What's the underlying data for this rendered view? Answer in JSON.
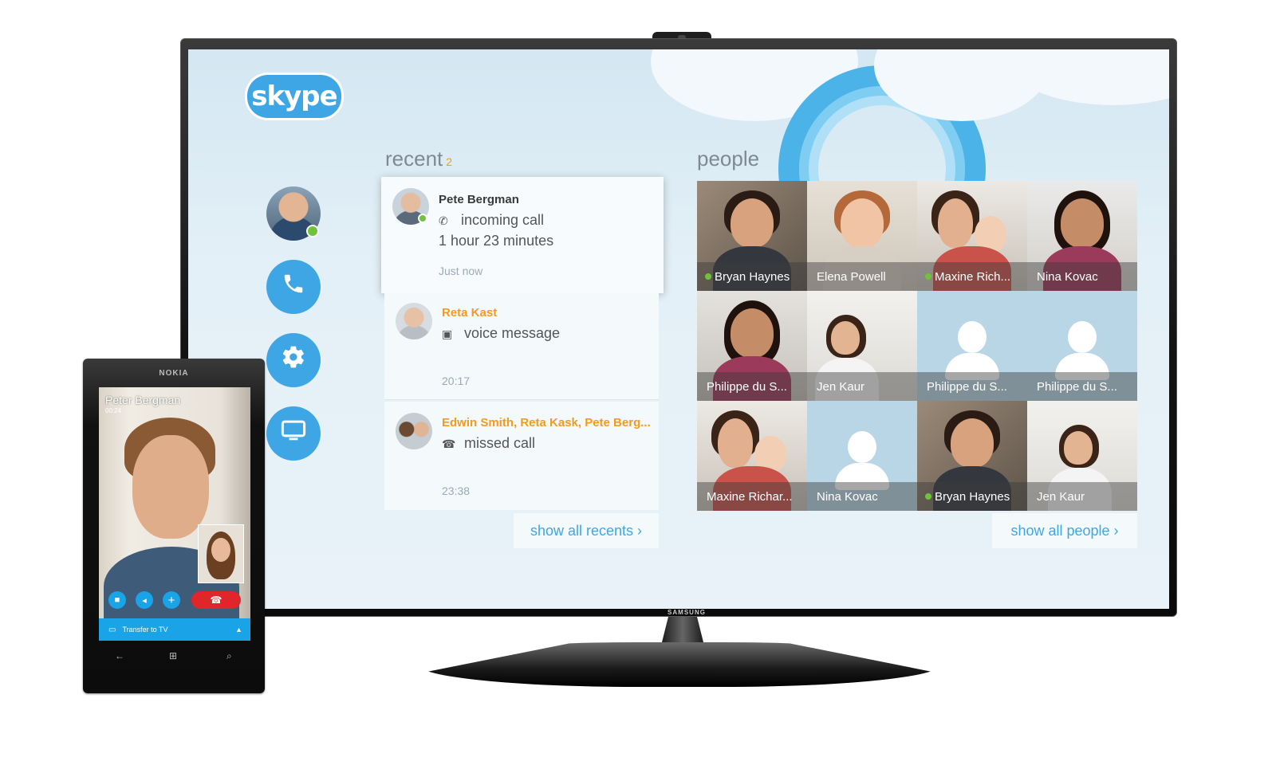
{
  "tv": {
    "brand": "SAMSUNG",
    "app": {
      "logo_text": "skype",
      "recent": {
        "title": "recent",
        "count": "2",
        "items": [
          {
            "name": "Pete Bergman",
            "type": "incoming call",
            "detail": "1 hour 23 minutes",
            "time": "Just now",
            "type_icon": "phone-icon"
          },
          {
            "name": "Reta Kast",
            "type": "voice message",
            "time": "20:17",
            "type_icon": "voicemail-icon"
          },
          {
            "name": "Edwin Smith, Reta Kask, Pete Berg...",
            "type": "missed call",
            "time": "23:38",
            "type_icon": "missed-call-icon"
          }
        ],
        "show_all": "show all recents ›"
      },
      "people": {
        "title": "people",
        "tiles": [
          {
            "name": "Bryan Haynes",
            "online": true
          },
          {
            "name": "Elena Powell",
            "online": false
          },
          {
            "name": "Maxine Rich...",
            "online": true
          },
          {
            "name": "Nina Kovac",
            "online": false
          },
          {
            "name": "Philippe du S...",
            "online": false
          },
          {
            "name": "Jen Kaur",
            "online": false
          },
          {
            "name": "Philippe du S...",
            "online": false
          },
          {
            "name": "Philippe du S...",
            "online": false
          },
          {
            "name": "Maxine Richar...",
            "online": false
          },
          {
            "name": "Nina Kovac",
            "online": false
          },
          {
            "name": "Bryan Haynes",
            "online": true
          },
          {
            "name": "Jen Kaur",
            "online": false
          }
        ],
        "show_all": "show all people ›"
      }
    }
  },
  "phone": {
    "brand": "NOKIA",
    "caller_name": "Peter Bergman",
    "call_timer": "00:24",
    "transfer_label": "Transfer to TV"
  }
}
